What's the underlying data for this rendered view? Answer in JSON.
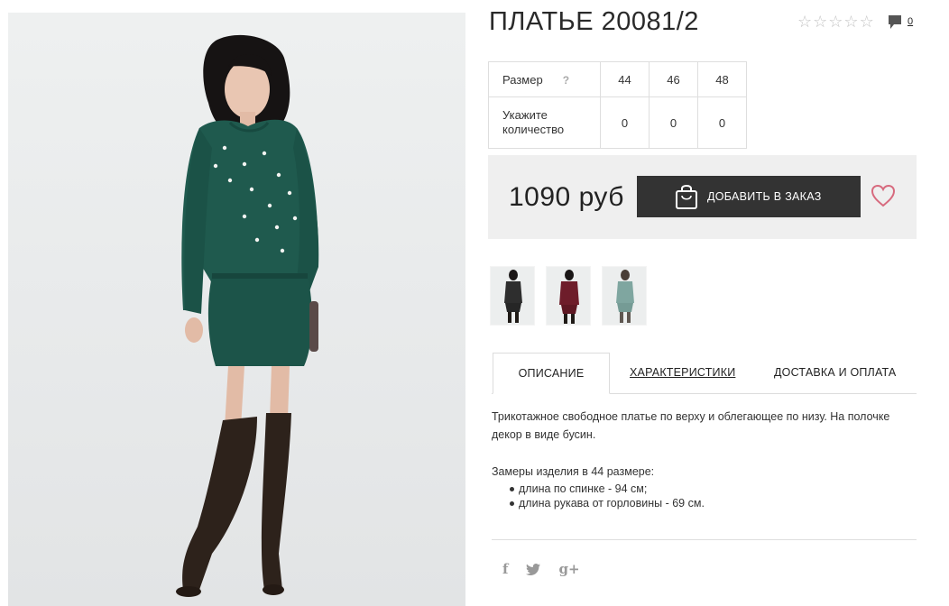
{
  "product": {
    "title": "ПЛАТЬЕ 20081/2",
    "rating_stars": 5,
    "rating_value": 0,
    "comments_count": "0"
  },
  "sizes": {
    "size_label": "Размер",
    "help": "?",
    "values": [
      "44",
      "46",
      "48"
    ],
    "qty_label_line1": "Укажите",
    "qty_label_line2": "количество",
    "quantities": [
      "0",
      "0",
      "0"
    ]
  },
  "buy": {
    "price": "1090 руб",
    "cart_button": "ДОБАВИТЬ В ЗАКАЗ",
    "wishlist_icon": "heart-icon"
  },
  "thumbnails": [
    {
      "name": "black",
      "color": "#2e2e2e"
    },
    {
      "name": "burgundy",
      "color": "#6e1d2a"
    },
    {
      "name": "mint",
      "color": "#7fa6a0"
    }
  ],
  "tabs": [
    "ОПИСАНИЕ",
    "ХАРАКТЕРИСТИКИ",
    "ДОСТАВКА И ОПЛАТА"
  ],
  "description": {
    "text": "Трикотажное свободное платье по верху и облегающее по низу. На полочке декор в виде бусин.",
    "measure_title": "Замеры изделия в 44 размере:",
    "measures": [
      "длина по спинке - 94 см;",
      "длина рукава от горловины - 69 см."
    ]
  },
  "social": [
    "f",
    "y",
    "g+"
  ],
  "colors": {
    "dress": "#1f5a4e",
    "button": "#333333",
    "heart": "#d76a7e",
    "panel": "#efefef"
  }
}
